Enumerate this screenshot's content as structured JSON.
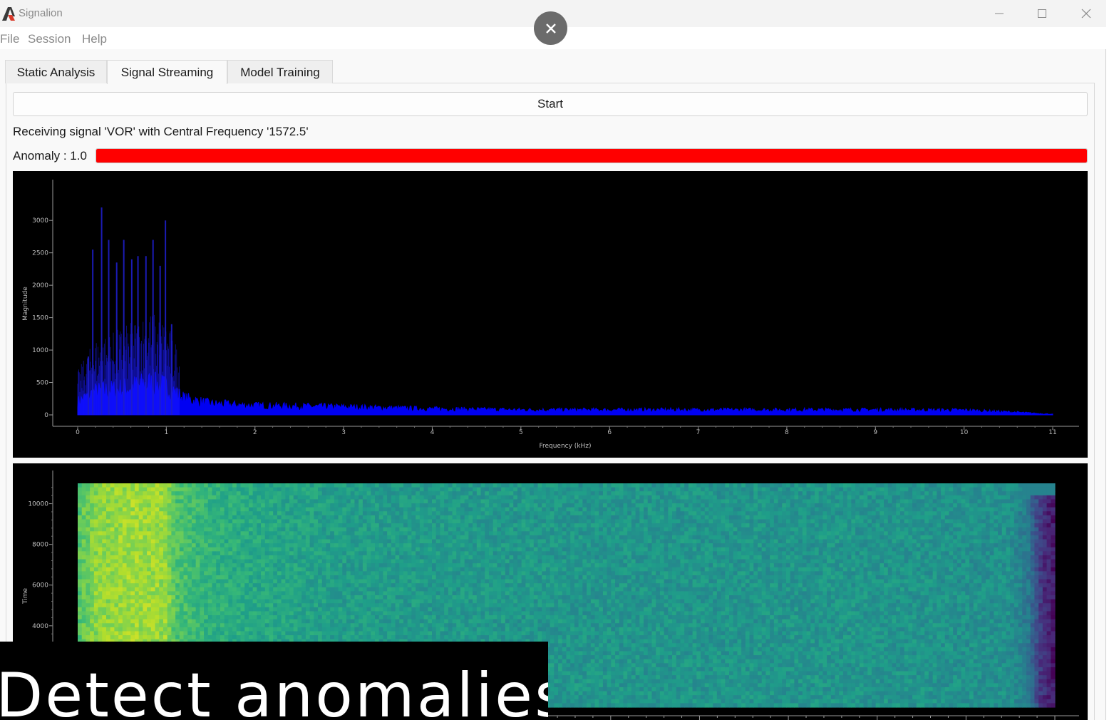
{
  "app": {
    "title": "Signalion",
    "logo_icon": "signalion-logo-icon",
    "window_controls": [
      "minimize-icon",
      "maximize-icon",
      "close-icon"
    ]
  },
  "menu": {
    "items": [
      "File",
      "Session",
      "Help"
    ]
  },
  "tabs": [
    {
      "label": "Static Analysis",
      "active": false
    },
    {
      "label": "Signal Streaming",
      "active": true
    },
    {
      "label": "Model Training",
      "active": false
    }
  ],
  "streaming": {
    "start_label": "Start",
    "status": "Receiving signal 'VOR' with Central Frequency '1572.5'",
    "anomaly_label": "Anomaly : 1.0",
    "anomaly_value": 1.0,
    "anomaly_color": "#ff0000"
  },
  "caption": {
    "text": "Detect anomalies"
  },
  "chart_data": [
    {
      "type": "area",
      "title": "",
      "xlabel": "Frequency (kHz)",
      "ylabel": "Magnitude",
      "xlim": [
        0,
        11
      ],
      "ylim": [
        0,
        3200
      ],
      "x_ticks": [
        0,
        1,
        2,
        3,
        4,
        5,
        6,
        7,
        8,
        9,
        10,
        11
      ],
      "y_ticks": [
        0,
        500,
        1000,
        1500,
        2000,
        2500,
        3000
      ],
      "color": "#0000ff",
      "grid": false,
      "peaks": [
        {
          "x": 0.12,
          "y": 900
        },
        {
          "x": 0.17,
          "y": 2550
        },
        {
          "x": 0.27,
          "y": 3200
        },
        {
          "x": 0.35,
          "y": 2700
        },
        {
          "x": 0.44,
          "y": 2350
        },
        {
          "x": 0.52,
          "y": 2700
        },
        {
          "x": 0.61,
          "y": 2400
        },
        {
          "x": 0.68,
          "y": 2450
        },
        {
          "x": 0.77,
          "y": 2450
        },
        {
          "x": 0.85,
          "y": 2700
        },
        {
          "x": 0.93,
          "y": 2300
        },
        {
          "x": 0.99,
          "y": 3000
        },
        {
          "x": 1.06,
          "y": 1400
        }
      ],
      "envelope": {
        "x": [
          0,
          0.2,
          0.4,
          0.6,
          0.8,
          1.0,
          1.2,
          1.5,
          2.0,
          3.0,
          4.0,
          5.0,
          6.0,
          7.0,
          8.0,
          9.0,
          10.0,
          10.5,
          11.0
        ],
        "y": [
          200,
          350,
          380,
          420,
          480,
          430,
          250,
          170,
          140,
          120,
          90,
          75,
          75,
          75,
          75,
          75,
          70,
          45,
          10
        ]
      }
    },
    {
      "type": "heatmap",
      "title": "",
      "xlabel": "",
      "ylabel": "Time",
      "xlim": [
        0,
        11
      ],
      "ylim": [
        0,
        11000
      ],
      "y_ticks": [
        4000,
        6000,
        8000,
        10000
      ],
      "colormap": "viridis",
      "frequency_profile": {
        "x": [
          0,
          0.2,
          0.6,
          1.0,
          1.1,
          1.5,
          2.0,
          3.0,
          6.0,
          9.0,
          10.5,
          10.7,
          10.85,
          11.0
        ],
        "level": [
          0.72,
          0.82,
          0.86,
          0.84,
          0.72,
          0.64,
          0.6,
          0.55,
          0.52,
          0.52,
          0.5,
          0.4,
          0.15,
          0.05
        ]
      }
    }
  ]
}
